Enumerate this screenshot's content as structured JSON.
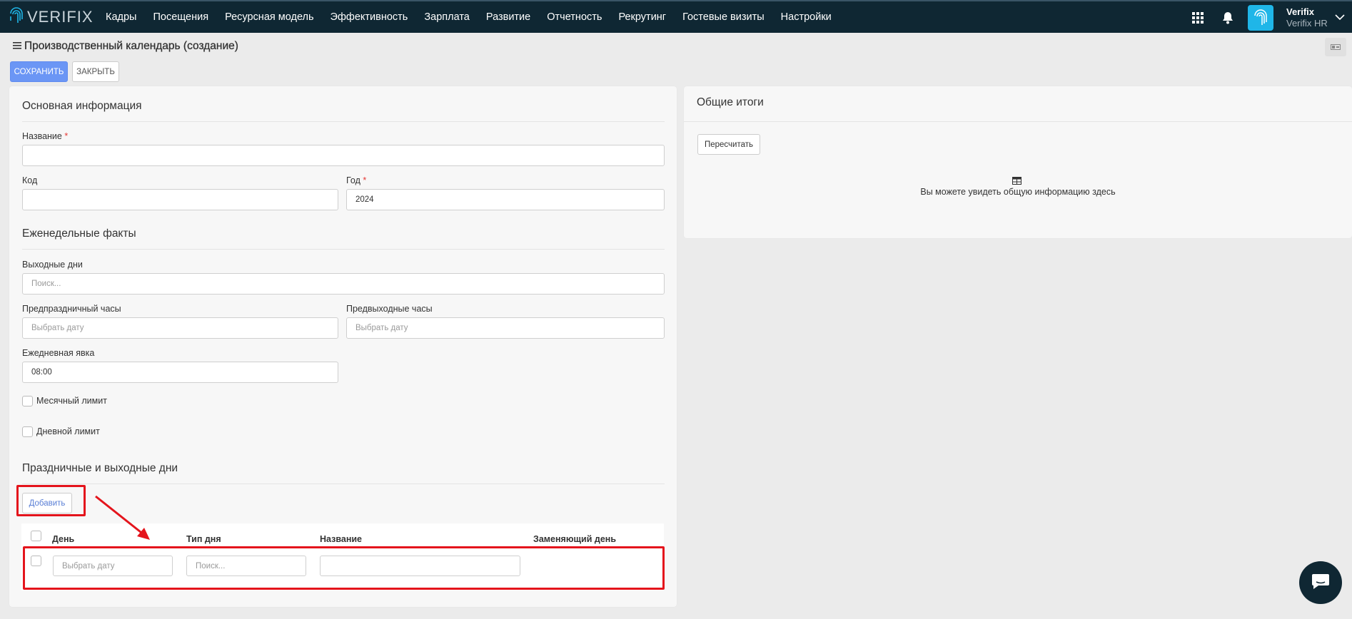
{
  "topbar": {
    "logo_text": "VERIFIX",
    "nav": [
      "Кадры",
      "Посещения",
      "Ресурсная модель",
      "Эффективность",
      "Зарплата",
      "Развитие",
      "Отчетность",
      "Рекрутинг",
      "Гостевые визиты",
      "Настройки"
    ],
    "user_name": "Verifix",
    "user_company": "Verifix HR"
  },
  "page": {
    "title": "Производственный календарь (создание)",
    "save_label": "СОХРАНИТЬ",
    "close_label": "ЗАКРЫТЬ"
  },
  "basic": {
    "title": "Основная информация",
    "name_label": "Название",
    "required_mark": "*",
    "name_value": "",
    "code_label": "Код",
    "code_value": "",
    "year_label": "Год",
    "year_value": "2024"
  },
  "weekly": {
    "title": "Еженедельные факты",
    "days_off_label": "Выходные дни",
    "days_off_placeholder": "Поиск...",
    "preholiday_label": "Предпраздничный часы",
    "preholiday_placeholder": "Выбрать дату",
    "preweekend_label": "Предвыходные часы",
    "preweekend_placeholder": "Выбрать дату",
    "daily_label": "Ежедневная явка",
    "daily_value": "08:00",
    "monthly_limit_label": "Месячный лимит",
    "daily_limit_label": "Дневной лимит"
  },
  "holidays": {
    "title": "Праздничные и выходные дни",
    "add_label": "Добавить",
    "columns": [
      "День",
      "Тип дня",
      "Название",
      "Заменяющий день"
    ],
    "row": {
      "day_placeholder": "Выбрать дату",
      "type_placeholder": "Поиск...",
      "name_value": ""
    }
  },
  "summary": {
    "title": "Общие итоги",
    "recalc_label": "Пересчитать",
    "empty_text": "Вы можете увидеть общую информацию здесь"
  },
  "colors": {
    "topbar": "#0f2733",
    "primary": "#6b96f5",
    "annotation": "#e4141c"
  }
}
